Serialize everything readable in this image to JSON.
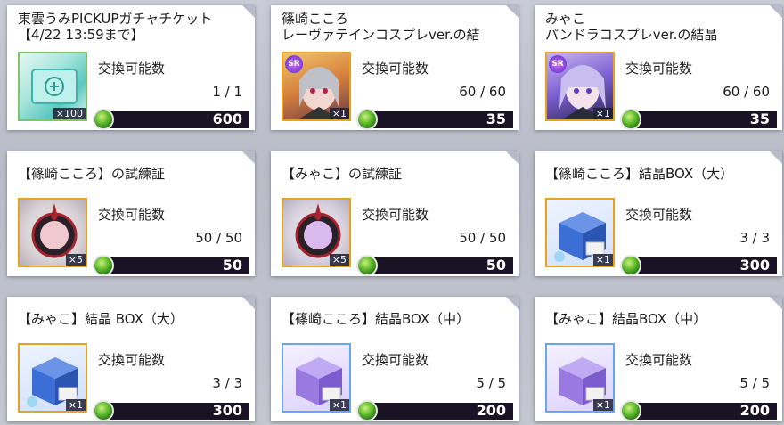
{
  "cards": [
    {
      "title": "東雲うみPICKUPガチャチケット\n【4/22 13:59まで】",
      "label": "交換可能数",
      "count": "1 / 1",
      "qty": "×100",
      "price": "600",
      "badge": "",
      "icon": "gacha-ticket-icon"
    },
    {
      "title": "篠崎こころ\nレーヴァテインコスプレver.の結",
      "label": "交換可能数",
      "count": "60 / 60",
      "qty": "×1",
      "price": "35",
      "badge": "SR",
      "icon": "character-crystal-icon"
    },
    {
      "title": "みゃこ\nパンドラコスプレver.の結晶",
      "label": "交換可能数",
      "count": "60 / 60",
      "qty": "×1",
      "price": "35",
      "badge": "SR",
      "icon": "character-crystal-icon"
    },
    {
      "title": "【篠崎こころ】の試練証",
      "label": "交換可能数",
      "count": "50 / 50",
      "qty": "×5",
      "price": "50",
      "badge": "",
      "icon": "trial-emblem-icon"
    },
    {
      "title": "【みゃこ】の試練証",
      "label": "交換可能数",
      "count": "50 / 50",
      "qty": "×5",
      "price": "50",
      "badge": "",
      "icon": "trial-emblem-icon"
    },
    {
      "title": "【篠崎こころ】結晶BOX（大）",
      "label": "交換可能数",
      "count": "3 / 3",
      "qty": "×1",
      "price": "300",
      "badge": "",
      "icon": "crystal-box-icon"
    },
    {
      "title": "【みゃこ】結晶 BOX（大）",
      "label": "交換可能数",
      "count": "3 / 3",
      "qty": "×1",
      "price": "300",
      "badge": "",
      "icon": "crystal-box-icon"
    },
    {
      "title": "【篠崎こころ】結晶BOX（中）",
      "label": "交換可能数",
      "count": "5 / 5",
      "qty": "×1",
      "price": "200",
      "badge": "",
      "icon": "crystal-box-icon"
    },
    {
      "title": "【みゃこ】結晶BOX（中）",
      "label": "交換可能数",
      "count": "5 / 5",
      "qty": "×1",
      "price": "200",
      "badge": "",
      "icon": "crystal-box-icon"
    }
  ],
  "currency_icon": "green-gem-icon",
  "colors": {
    "price_bar": "#1a1326",
    "frame_gold": "#e8a62a",
    "frame_green": "#7fc56b",
    "box_blue": "#3b6fd6",
    "box_purple": "#9a7ae0"
  }
}
